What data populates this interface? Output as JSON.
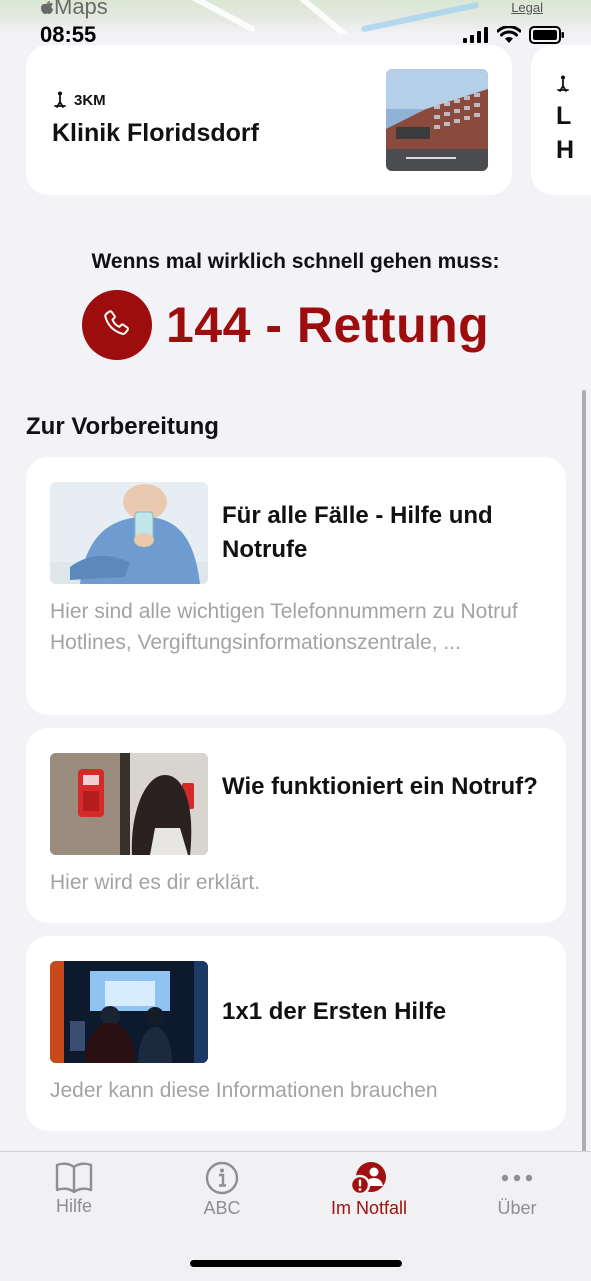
{
  "map": {
    "logo": "Maps",
    "legal": "Legal"
  },
  "status": {
    "time": "08:55"
  },
  "hospital": {
    "distance": "3KM",
    "name": "Klinik Floridsdorf",
    "next_card_preview": "L H"
  },
  "emergency": {
    "prompt": "Wenns mal wirklich schnell gehen muss:",
    "number_label": "144 - Rettung"
  },
  "section": {
    "title": "Zur Vorbereitung"
  },
  "cards": [
    {
      "title": "Für alle Fälle - Hilfe und Notrufe",
      "description": "Hier sind alle wichtigen Telefonnummern zu Notruf Hotlines, Vergiftungsinformationszentrale, ..."
    },
    {
      "title": "Wie funktioniert ein Notruf?",
      "description": "Hier wird es dir erklärt."
    },
    {
      "title": "1x1 der Ersten Hilfe",
      "description": "Jeder kann diese Informationen brauchen"
    }
  ],
  "tabs": [
    {
      "label": "Hilfe",
      "icon": "book-icon"
    },
    {
      "label": "ABC",
      "icon": "info-icon"
    },
    {
      "label": "Im Notfall",
      "icon": "emergency-person-icon"
    },
    {
      "label": "Über",
      "icon": "more-icon"
    }
  ],
  "colors": {
    "accent": "#9e0d0d",
    "background": "#f2f2f7",
    "muted": "#a3a3a3"
  }
}
